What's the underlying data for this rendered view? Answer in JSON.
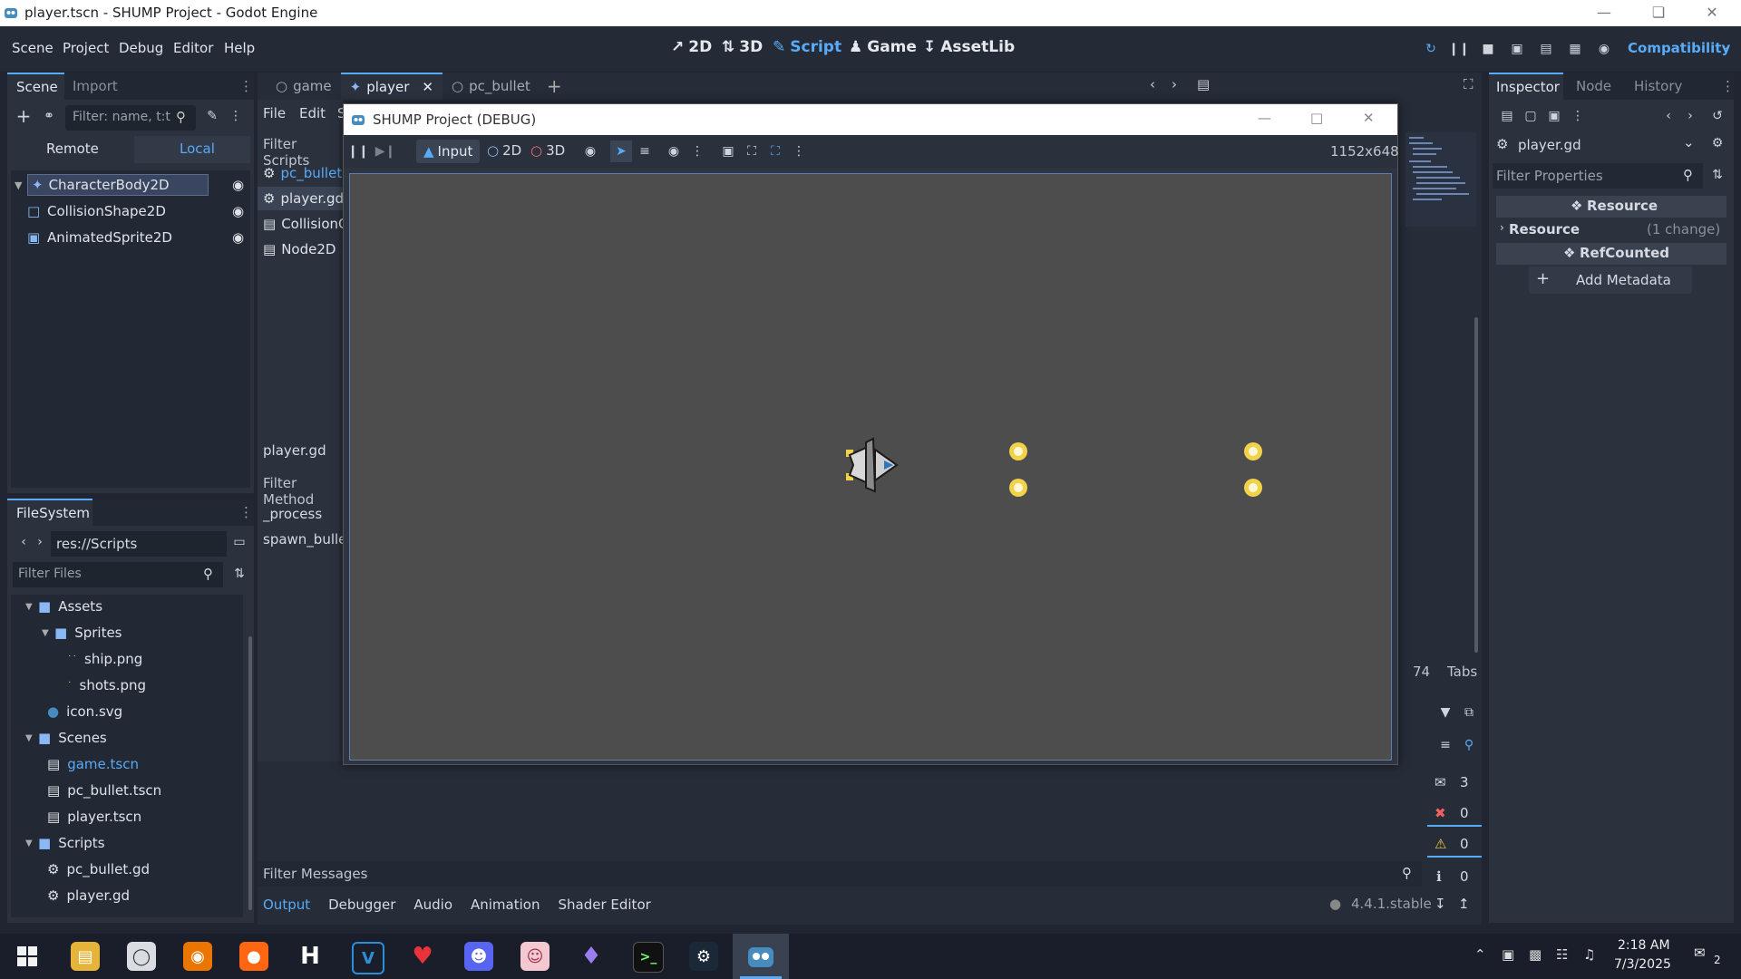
{
  "os_window": {
    "title": "player.tscn - SHUMP Project - Godot Engine"
  },
  "menu": {
    "items": [
      "Scene",
      "Project",
      "Debug",
      "Editor",
      "Help"
    ],
    "workspaces": [
      "2D",
      "3D",
      "Script",
      "Game",
      "AssetLib"
    ],
    "active_workspace": "Script",
    "renderer": "Compatibility"
  },
  "scene_dock": {
    "tabs": [
      "Scene",
      "Import"
    ],
    "filter_placeholder": "Filter: name, t:t",
    "remote_label": "Remote",
    "local_label": "Local",
    "nodes": [
      "CharacterBody2D",
      "CollisionShape2D",
      "AnimatedSprite2D"
    ]
  },
  "filesystem": {
    "tab": "FileSystem",
    "path": "res://Scripts",
    "filter_placeholder": "Filter Files",
    "items": [
      {
        "name": "Assets",
        "type": "folder"
      },
      {
        "name": "Sprites",
        "type": "folder"
      },
      {
        "name": "ship.png",
        "type": "image"
      },
      {
        "name": "shots.png",
        "type": "image"
      },
      {
        "name": "icon.svg",
        "type": "svg"
      },
      {
        "name": "Scenes",
        "type": "folder"
      },
      {
        "name": "game.tscn",
        "type": "scene"
      },
      {
        "name": "pc_bullet.tscn",
        "type": "scene"
      },
      {
        "name": "player.tscn",
        "type": "scene"
      },
      {
        "name": "Scripts",
        "type": "folder"
      },
      {
        "name": "pc_bullet.gd",
        "type": "script"
      },
      {
        "name": "player.gd",
        "type": "script"
      }
    ]
  },
  "scene_tabs": [
    "game",
    "player",
    "pc_bullet"
  ],
  "script_editor": {
    "menu": [
      "File",
      "Edit",
      "S"
    ],
    "filter_scripts": "Filter Scripts",
    "scripts": [
      "pc_bullet.",
      "player.gd",
      "CollisionC",
      "Node2D"
    ],
    "current_script": "player.gd",
    "filter_methods": "Filter Method",
    "methods": [
      "_process",
      "spawn_bullet"
    ],
    "line_number": "74",
    "indent_mode": "Tabs"
  },
  "game_window": {
    "title": "SHUMP Project (DEBUG)",
    "input_label": "Input",
    "mode_2d": "2D",
    "mode_3d": "3D",
    "resolution": "1152x648"
  },
  "bottom_panel": {
    "filter_messages": "Filter Messages",
    "tabs": [
      "Output",
      "Debugger",
      "Audio",
      "Animation",
      "Shader Editor"
    ],
    "version": "4.4.1.stable",
    "counts": {
      "messages": "3",
      "errors": "0",
      "warnings": "0",
      "other": "0"
    }
  },
  "inspector": {
    "tabs": [
      "Inspector",
      "Node",
      "History"
    ],
    "object": "player.gd",
    "filter_placeholder": "Filter Properties",
    "section_resource": "Resource",
    "resource_row": "Resource",
    "resource_change": "(1 change)",
    "section_refcounted": "RefCounted",
    "add_metadata": "Add Metadata"
  },
  "taskbar": {
    "time": "2:18 AM",
    "date": "7/3/2025",
    "notifications": "2"
  },
  "colors": {
    "accent": "#59aaf7",
    "error": "#f06060",
    "warning": "#f5c542",
    "bullet": "#f1d24a"
  }
}
